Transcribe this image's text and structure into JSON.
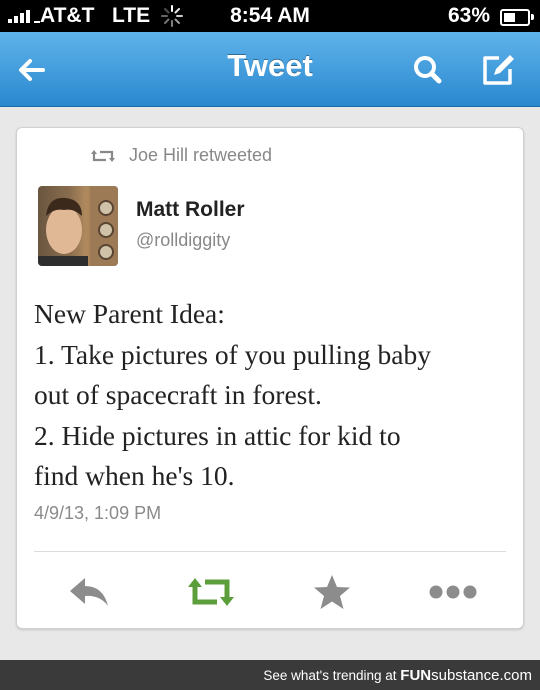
{
  "status_bar": {
    "carrier": "AT&T",
    "network": "LTE",
    "time": "8:54 AM",
    "battery": "63%",
    "battery_level": 0.63
  },
  "nav": {
    "title": "Tweet",
    "back_icon": "back-arrow-icon",
    "search_icon": "search-icon",
    "compose_icon": "compose-icon"
  },
  "tweet": {
    "retweeted_by": "Joe Hill retweeted",
    "author_name": "Matt Roller",
    "author_handle": "@rolldiggity",
    "text_lines": [
      "New Parent Idea:",
      "1. Take pictures of you pulling baby",
      "out of spacecraft in forest.",
      "2. Hide pictures in attic for kid to",
      "find when he's 10."
    ],
    "timestamp": "4/9/13, 1:09 PM"
  },
  "actions": {
    "reply_icon": "reply-icon",
    "retweet_icon": "retweet-icon",
    "favorite_icon": "star-icon",
    "more_icon": "more-icon",
    "retweet_color": "#5c9e3c",
    "icon_color": "#8c8c8c"
  },
  "footer": {
    "text": "See what's trending at",
    "brand_prefix": "FUN",
    "brand_suffix": "substance.com"
  }
}
